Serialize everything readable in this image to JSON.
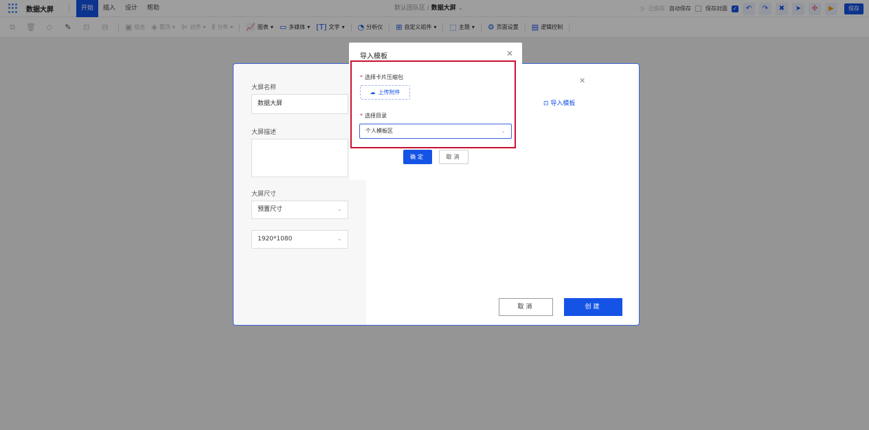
{
  "topbar": {
    "app_title": "数据大屏",
    "menu": [
      "开始",
      "插入",
      "设计",
      "帮助"
    ],
    "breadcrumb_team": "默认团队区 / ",
    "breadcrumb_current": "数据大屏",
    "saved_status": "已保存",
    "auto_save_label": "自动保存",
    "save_cover_label": "保存封面",
    "save_label": "保存"
  },
  "toolbar": {
    "group": "组合",
    "layer": "置顶",
    "align": "对齐",
    "distribute": "分布",
    "chart": "图表",
    "media": "多媒体",
    "text": "文字",
    "analyzer": "分析仪",
    "custom": "自定义组件",
    "theme": "主题",
    "page_settings": "页面设置",
    "logic": "逻辑控制"
  },
  "create_panel": {
    "name_label": "大屏名称",
    "name_value": "数据大屏",
    "desc_label": "大屏描述",
    "size_label": "大屏尺寸",
    "size_preset": "预置尺寸",
    "size_value": "1920*1080",
    "import_link": "导入模板",
    "cancel": "取消",
    "create": "创建"
  },
  "import_modal": {
    "title": "导入模板",
    "zip_label": "选择卡片压缩包",
    "upload_label": "上传附件",
    "dir_label": "选择目录",
    "dir_value": "个人模板区",
    "confirm": "确定",
    "cancel": "取消"
  },
  "colors": {
    "primary": "#1453e6",
    "highlight": "#c8102e",
    "required": "#e33333"
  }
}
